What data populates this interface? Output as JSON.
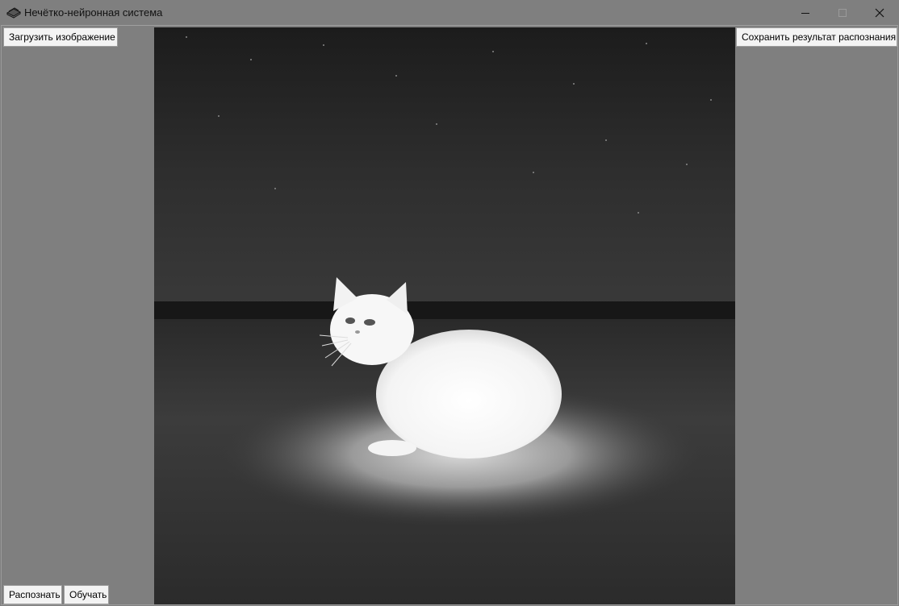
{
  "window": {
    "title": "Нечётко-нейронная система",
    "icons": {
      "app": "books-icon",
      "minimize": "minimize-icon",
      "maximize": "maximize-icon",
      "close": "close-icon"
    }
  },
  "toolbar": {
    "load_label": "Загрузить изображение",
    "save_label": "Сохранить результат распознания",
    "recognize_label": "Распознать",
    "train_label": "Обучать"
  },
  "image": {
    "subject": "white-kitten-at-night",
    "mode": "grayscale"
  },
  "colors": {
    "background": "#7f7f7f",
    "button_face": "#f3f3f3",
    "button_border": "#9c9c9c"
  }
}
